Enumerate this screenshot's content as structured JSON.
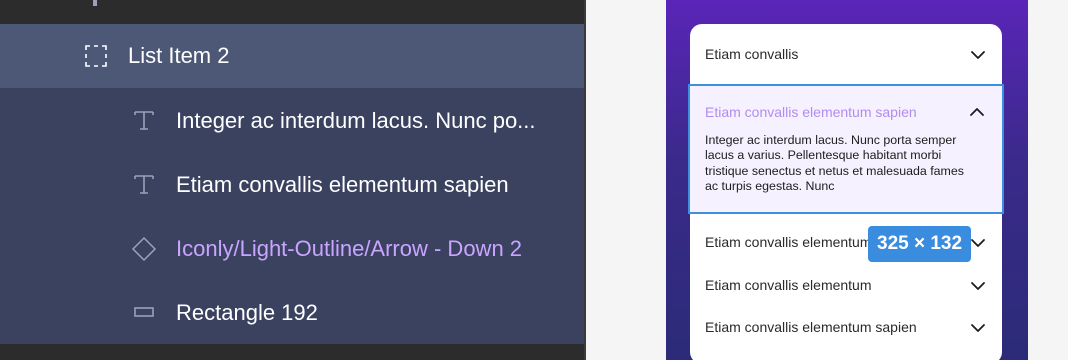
{
  "layers": {
    "items": [
      {
        "label": "List Item 2",
        "icon": "frame-dashed-icon"
      },
      {
        "label": "Integer ac interdum lacus. Nunc po...",
        "icon": "text-icon"
      },
      {
        "label": "Etiam convallis elementum sapien",
        "icon": "text-icon"
      },
      {
        "label": "Iconly/Light-Outline/Arrow - Down 2",
        "icon": "component-instance-icon"
      },
      {
        "label": "Rectangle 192",
        "icon": "rectangle-icon"
      }
    ]
  },
  "canvas": {
    "accordion": {
      "items": [
        {
          "title": "Etiam convallis",
          "expanded": false,
          "icon": "chevron-down-icon"
        },
        {
          "title": "Etiam convallis elementum sapien",
          "expanded": true,
          "icon": "chevron-up-icon",
          "body": "Integer ac interdum lacus. Nunc porta semper lacus a varius. Pellentesque habitant morbi tristique senectus et netus et malesuada fames ac turpis egestas. Nunc"
        },
        {
          "title": "Etiam convallis elementum sapien",
          "expanded": false,
          "icon": "chevron-down-icon"
        },
        {
          "title": "Etiam convallis elementum",
          "expanded": false,
          "icon": "chevron-down-icon"
        },
        {
          "title": "Etiam convallis elementum sapien",
          "expanded": false,
          "icon": "chevron-down-icon"
        }
      ]
    },
    "selection_size": "325 × 132"
  },
  "colors": {
    "selected_row": "#4d5877",
    "child_row": "#3a4260",
    "component_text": "#c9a5ff",
    "selection_blue": "#3d8fe0",
    "expanded_title": "#b18cf0"
  }
}
